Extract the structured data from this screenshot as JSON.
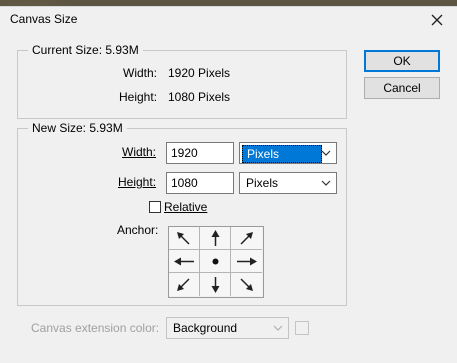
{
  "window": {
    "title": "Canvas Size",
    "close_icon": "close-icon"
  },
  "current_size": {
    "group_label": "Current Size: 5.93M",
    "width_label": "Width:",
    "width_value": "1920 Pixels",
    "height_label": "Height:",
    "height_value": "1080 Pixels"
  },
  "new_size": {
    "group_label": "New Size: 5.93M",
    "width_label": "Width:",
    "width_value": "1920",
    "width_unit": "Pixels",
    "height_label": "Height:",
    "height_value": "1080",
    "height_unit": "Pixels",
    "relative_label": "Relative",
    "relative_checked": false,
    "anchor_label": "Anchor:",
    "anchor_icons": [
      "arrow-up-left-icon",
      "arrow-up-icon",
      "arrow-up-right-icon",
      "arrow-left-icon",
      "anchor-center-dot-icon",
      "arrow-right-icon",
      "arrow-down-left-icon",
      "arrow-down-icon",
      "arrow-down-right-icon"
    ]
  },
  "extension": {
    "label": "Canvas extension color:",
    "value": "Background",
    "enabled": false
  },
  "buttons": {
    "ok": "OK",
    "cancel": "Cancel"
  },
  "colors": {
    "accent": "#0078d7",
    "dialog_bg": "#f0f0f0",
    "disabled_text": "#a0a0a0"
  }
}
